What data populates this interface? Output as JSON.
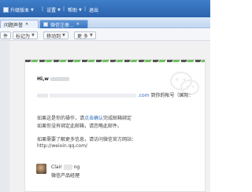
{
  "menubar": {
    "item_a": "升级版本",
    "item_b": "设置",
    "item_c": "帮助",
    "item_d": "退出",
    "separator": "|"
  },
  "tabs": [
    {
      "label": "问题声誉"
    },
    {
      "label": "微信注册..."
    }
  ],
  "toolbar": {
    "btn_1": "件",
    "btn_2": "标记为",
    "btn_3": "移动到",
    "btn_4": "更 多"
  },
  "email": {
    "greeting": "Hi,w",
    "line1_link": ".com",
    "line1_text": "到你的帐号（国际：",
    "para1_line1_a": "如果这是你的操作，请",
    "para1_line1_link": "点击确认",
    "para1_line1_b": "完成邮箱绑定",
    "para1_line2": "如果你没有绑定此邮箱，请忽略此邮件。",
    "para2_line1": "如果需要了解更多信息，请访问微信官方网站：",
    "para2_url": "http://weixin.qq.com/",
    "signature_name_a": "Clair",
    "signature_name_b": "ng",
    "signature_title": "微信产品经理"
  },
  "icons": {
    "watermark": "wechat-logo-icon",
    "avatar": "avatar"
  },
  "colors": {
    "menubar": "#2f6bb8",
    "active_tab": "#3a75c0",
    "link": "#2a65b8",
    "stripe_green": "#6fbf5f",
    "stripe_dark": "#555555"
  }
}
